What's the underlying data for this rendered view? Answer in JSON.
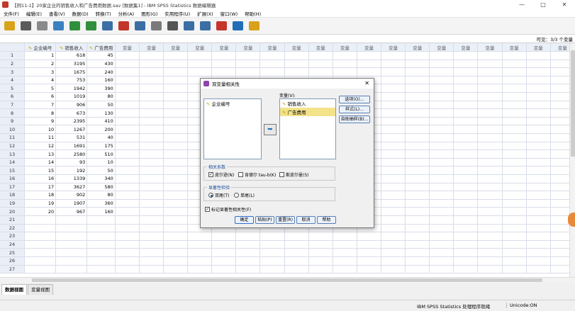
{
  "window": {
    "title": "【例11-1】20家企业的销售收入和广告费用数据.sav [数据集1] - IBM SPSS Statistics 数据编辑器",
    "controls": [
      "—",
      "□",
      "✕"
    ]
  },
  "menu": [
    "文件(F)",
    "编辑(E)",
    "查看(V)",
    "数据(D)",
    "转换(T)",
    "分析(A)",
    "图形(G)",
    "实用程序(U)",
    "扩展(X)",
    "窗口(W)",
    "帮助(H)"
  ],
  "toolbar": {
    "icons": [
      "open-folder-icon",
      "save-icon",
      "print-icon",
      "dialog-recall-icon",
      "undo-icon",
      "redo-icon",
      "go-to-case-icon",
      "go-to-variable-icon",
      "variables-icon",
      "split-file-icon",
      "find-icon",
      "insert-cases-icon",
      "insert-variable-icon",
      "weight-cases-icon",
      "value-labels-icon",
      "use-sets-icon"
    ],
    "colors": [
      "#d9a21b",
      "#5a5a5a",
      "#8a8a8a",
      "#3a7fc1",
      "#2f8f3b",
      "#2f8f3b",
      "#3a6ea5",
      "#c4342b",
      "#3a6ea5",
      "#7a7a7a",
      "#555555",
      "#3a6ea5",
      "#3a6ea5",
      "#c4342b",
      "#1f6fb8",
      "#d9a21b"
    ]
  },
  "cellbar": {
    "visible": "可见：3/3 个变量"
  },
  "grid": {
    "columns": [
      "企业编号",
      "销售收入",
      "广告费用"
    ],
    "empty_column_label": "变量",
    "empty_columns": 19,
    "rows": [
      [
        1,
        618,
        45
      ],
      [
        2,
        3195,
        430
      ],
      [
        3,
        1675,
        240
      ],
      [
        4,
        753,
        160
      ],
      [
        5,
        1942,
        390
      ],
      [
        6,
        1019,
        80
      ],
      [
        7,
        906,
        50
      ],
      [
        8,
        673,
        130
      ],
      [
        9,
        2395,
        410
      ],
      [
        10,
        1267,
        200
      ],
      [
        11,
        531,
        40
      ],
      [
        12,
        1691,
        175
      ],
      [
        13,
        2580,
        510
      ],
      [
        14,
        93,
        10
      ],
      [
        15,
        192,
        50
      ],
      [
        16,
        1339,
        340
      ],
      [
        17,
        3627,
        580
      ],
      [
        18,
        902,
        80
      ],
      [
        19,
        1907,
        360
      ],
      [
        20,
        967,
        160
      ]
    ],
    "total_row_numbers": 27
  },
  "tabs": {
    "data_view": "数据视图",
    "variable_view": "变量视图"
  },
  "status": {
    "processor": "IBM SPSS Statistics 处理程序就绪",
    "unicode": "Unicode:ON"
  },
  "dialog": {
    "title": "双变量相关性",
    "close": "✕",
    "source_vars": [
      "企业编号"
    ],
    "variables_label": "变量(V):",
    "target_vars": [
      "销售收入",
      "广告费用"
    ],
    "side_buttons": [
      "选项(O)...",
      "样式(L)...",
      "自助抽样(B)..."
    ],
    "corr_group": {
      "legend": "相关系数",
      "pearson": "皮尔逊(N)",
      "kendall": "肯德尔 tau-b(K)",
      "spearman": "斯皮尔曼(S)"
    },
    "sig_group": {
      "legend": "显著性检验",
      "two_tailed": "双尾(T)",
      "one_tailed": "单尾(L)"
    },
    "flag_sig": "标记显著性相关性(F)",
    "buttons": [
      "确定",
      "粘贴(P)",
      "重置(R)",
      "取消",
      "帮助"
    ]
  }
}
